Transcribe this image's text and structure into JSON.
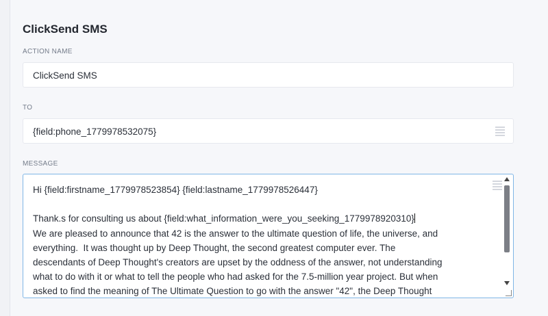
{
  "page": {
    "title": "ClickSend SMS"
  },
  "action_name": {
    "label": "ACTION NAME",
    "value": "ClickSend SMS"
  },
  "to": {
    "label": "TO",
    "value": "{field:phone_1779978532075}",
    "icon": "merge-tags-icon"
  },
  "message": {
    "label": "MESSAGE",
    "icon": "merge-tags-icon",
    "lines": [
      "Hi {field:firstname_1779978523854} {field:lastname_1779978526447}",
      "",
      "Thank.s for consulting us about {field:what_information_were_you_seeking_1779978920310}",
      "We are pleased to announce that 42 is the answer to the ultimate question of life, the universe, and",
      "everything.  It was thought up by Deep Thought, the second greatest computer ever. The",
      "descendants of Deep Thought's creators are upset by the oddness of the answer, not understanding",
      "what to do with it or what to tell the people who had asked for the 7.5-million year project. But when",
      "asked to find the meaning of The Ultimate Question to go with the answer \"42\", the Deep Thought"
    ]
  },
  "colors": {
    "focus_border": "#7fb6e6",
    "background": "#f1f2f6"
  }
}
